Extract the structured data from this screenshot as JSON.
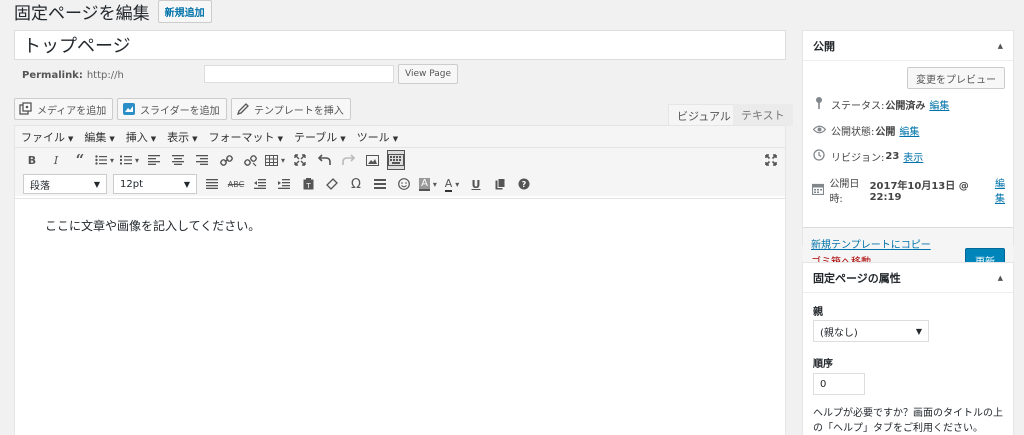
{
  "page": {
    "title": "固定ページを編集",
    "add_new": "新規追加"
  },
  "post": {
    "title": "トップページ",
    "permalink_label": "Permalink:",
    "permalink_url": "http://h",
    "permalink_slash": "/",
    "view_page": "View Page"
  },
  "media_buttons": {
    "add_media": "メディアを追加",
    "add_slider": "スライダーを追加",
    "insert_template": "テンプレートを挿入"
  },
  "editor_tabs": {
    "visual": "ビジュアル",
    "text": "テキスト"
  },
  "menubar": [
    "ファイル",
    "編集",
    "挿入",
    "表示",
    "フォーマット",
    "テーブル",
    "ツール"
  ],
  "toolbar1": {
    "bold": "B",
    "italic": "I",
    "blockquote": "“"
  },
  "toolbar2": {
    "format_value": "段落",
    "fontsize_value": "12pt",
    "special_char": "Ω"
  },
  "content": "ここに文章や画像を記入してください。",
  "publish_box": {
    "title": "公開",
    "preview": "変更をプレビュー",
    "status_label": "ステータス:",
    "status_value": "公開済み",
    "visibility_label": "公開状態:",
    "visibility_value": "公開",
    "revisions_label": "リビジョン:",
    "revisions_value": "23",
    "revisions_link": "表示",
    "published_label": "公開日時:",
    "published_value": "2017年10月13日 @ 22:19",
    "edit": "編集",
    "copy_template": "新規テンプレートにコピー",
    "trash": "ゴミ箱へ移動",
    "update": "更新"
  },
  "attributes_box": {
    "title": "固定ページの属性",
    "parent_label": "親",
    "parent_value": "(親なし)",
    "order_label": "順序",
    "order_value": "0",
    "help": "ヘルプが必要ですか？画面のタイトルの上の「ヘルプ」タブをご利用ください。"
  },
  "colors": {
    "primary": "#0085ba",
    "link": "#0073aa",
    "trash": "#aa0000"
  }
}
